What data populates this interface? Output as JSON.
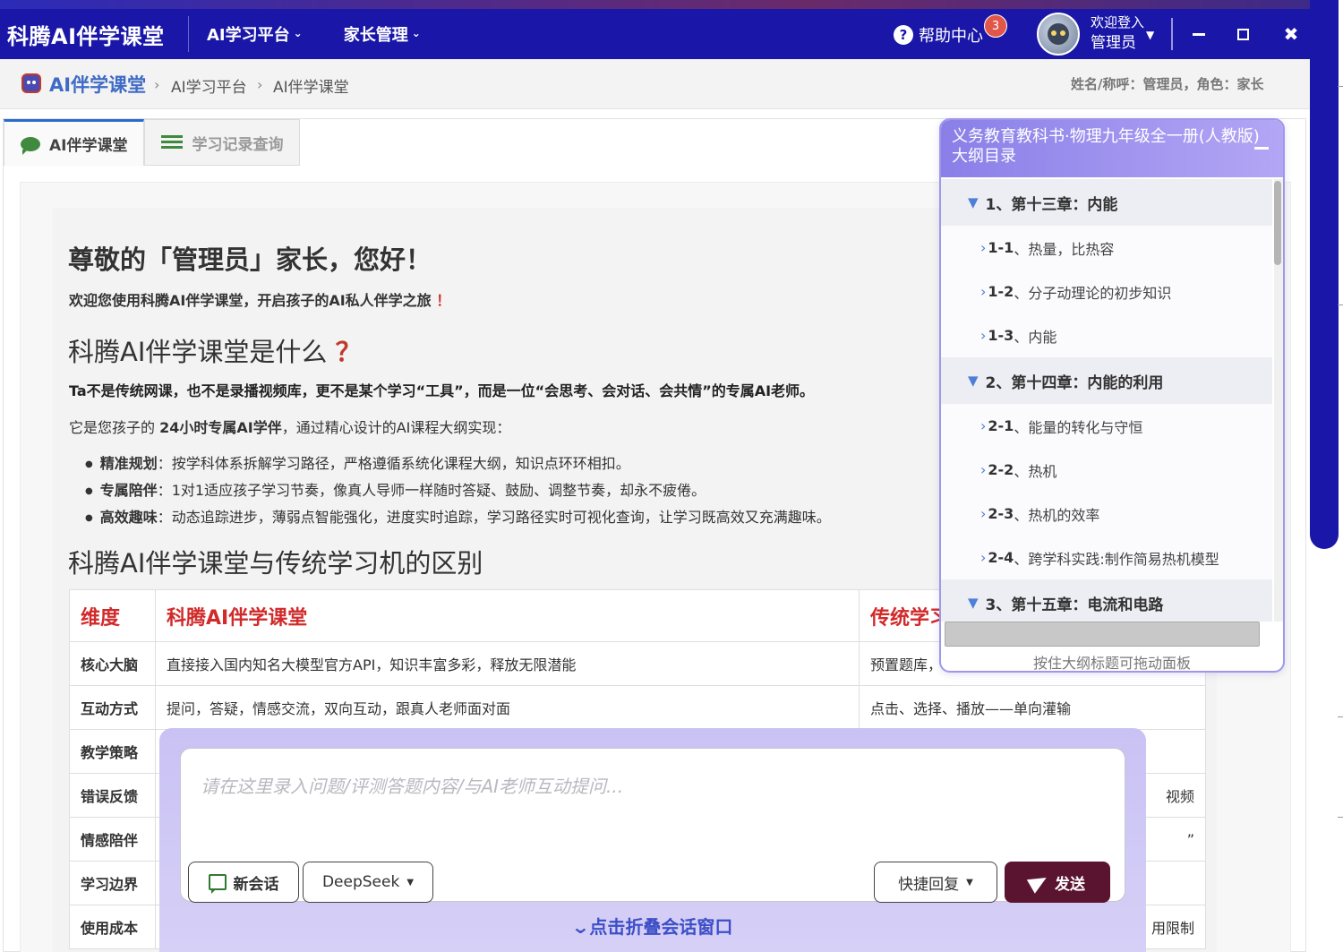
{
  "header": {
    "brand": "科腾AI伴学课堂",
    "nav": [
      {
        "label": "AI学习平台"
      },
      {
        "label": "家长管理"
      }
    ],
    "help_label": "帮助中心",
    "help_badge": "3",
    "welcome": "欢迎登入",
    "user_name": "管理员"
  },
  "breadcrumb": {
    "home": "AI伴学课堂",
    "items": [
      "AI学习平台",
      "AI伴学课堂"
    ],
    "user_info": "姓名/称呼：管理员，角色：家长"
  },
  "tabs": [
    {
      "label": "AI伴学课堂",
      "active": true
    },
    {
      "label": "学习记录查询",
      "active": false
    }
  ],
  "content": {
    "greeting": "尊敬的「管理员」家长，您好！",
    "welcome_line": "欢迎您使用科腾AI伴学课堂，开启孩子的AI私人伴学之旅",
    "welcome_mark": "！",
    "what_title": "科腾AI伴学课堂是什么",
    "what_mark": "？",
    "bold_line": "Ta不是传统网课，也不是录播视频库，更不是某个学习“工具”，而是一位“会思考、会对话、会共情”的专属AI老师。",
    "intro_prefix": "它是您孩子的 ",
    "intro_bold": "24小时专属AI学伴",
    "intro_suffix": "，通过精心设计的AI课程大纲实现：",
    "bullets": [
      {
        "title": "精准规划",
        "text": "：按学科体系拆解学习路径，严格遵循系统化课程大纲，知识点环环相扣。"
      },
      {
        "title": "专属陪伴",
        "text": "：1对1适应孩子学习节奏，像真人导师一样随时答疑、鼓励、调整节奏，却永不疲倦。"
      },
      {
        "title": "高效趣味",
        "text": "：动态追踪进步，薄弱点智能强化，进度实时追踪，学习路径实时可视化查询，让学习既高效又充满趣味。"
      }
    ],
    "diff_title": "科腾AI伴学课堂与传统学习机的区别"
  },
  "table": {
    "headers": [
      "维度",
      "科腾AI伴学课堂",
      "传统学习机"
    ],
    "rows": [
      {
        "dim": "核心大脑",
        "ai": "直接接入国内知名大模型官方API，知识丰富多彩，释放无限潜能",
        "trad": "预置题库，"
      },
      {
        "dim": "互动方式",
        "ai": "提问，答疑，情感交流，双向互动，跟真人老师面对面",
        "trad": "点击、选择、播放——单向灌输"
      },
      {
        "dim": "教学策略",
        "ai": "",
        "trad": ""
      },
      {
        "dim": "错误反馈",
        "ai": "",
        "trad": "视频"
      },
      {
        "dim": "情感陪伴",
        "ai": "",
        "trad": "”"
      },
      {
        "dim": "学习边界",
        "ai": "",
        "trad": ""
      },
      {
        "dim": "使用成本",
        "ai": "",
        "trad": "用限制"
      }
    ]
  },
  "outline": {
    "title": "义务教育教科书·物理九年级全一册(人教版)大纲目录",
    "chapters": [
      {
        "label": "1、第十三章：内能",
        "sections": [
          {
            "num": "1-1",
            "title": "、热量，比热容"
          },
          {
            "num": "1-2",
            "title": "、分子动理论的初步知识"
          },
          {
            "num": "1-3",
            "title": "、内能"
          }
        ]
      },
      {
        "label": "2、第十四章：内能的利用",
        "sections": [
          {
            "num": "2-1",
            "title": "、能量的转化与守恒"
          },
          {
            "num": "2-2",
            "title": "、热机"
          },
          {
            "num": "2-3",
            "title": "、热机的效率"
          },
          {
            "num": "2-4",
            "title": "、跨学科实践:制作简易热机模型"
          }
        ]
      },
      {
        "label": "3、第十五章：电流和电路",
        "sections": []
      }
    ],
    "hint": "按住大纲标题可拖动面板"
  },
  "composer": {
    "placeholder": "请在这里录入问题/评测答题内容/与AI老师互动提问...",
    "new_chat": "新会话",
    "model": "DeepSeek",
    "quick_reply": "快捷回复",
    "send": "发送",
    "collapse": "点击折叠会话窗口"
  },
  "colors": {
    "header_bg": "#1a17a8",
    "accent_red": "#d12a2a",
    "send_bg": "#5a1430",
    "outline_head": "#8a7fe8"
  }
}
